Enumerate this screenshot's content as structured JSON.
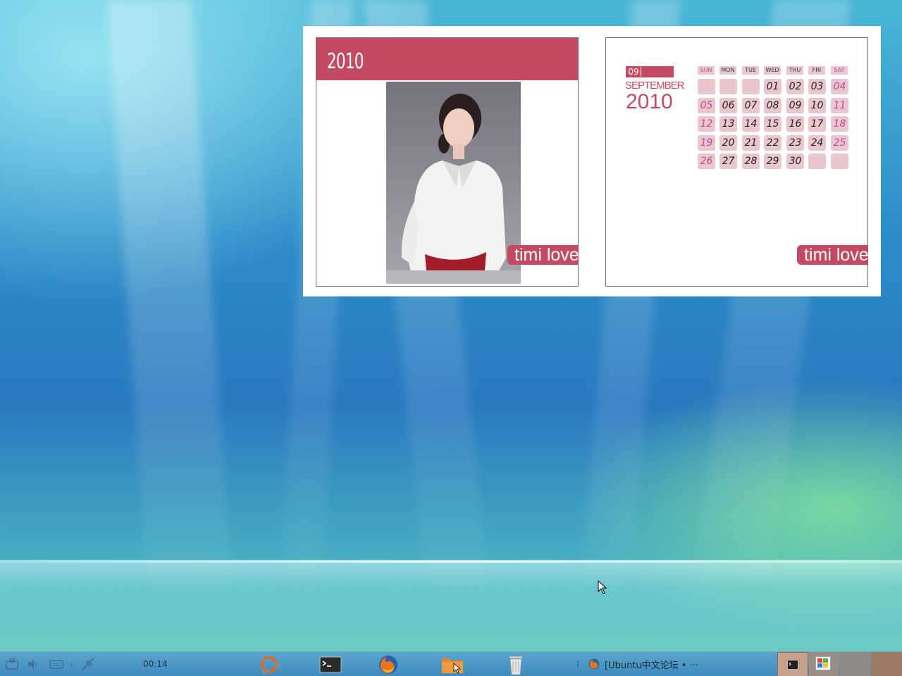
{
  "calendar": {
    "photo_year": "2010",
    "photo_tag": "timi love",
    "month_number": "09",
    "month_name": "SEPTEMBER",
    "year": "2010",
    "calendar_tag": "timi love",
    "weekdays": [
      "SUN",
      "MON",
      "TUE",
      "WED",
      "THU",
      "FRI",
      "SAT"
    ],
    "weeks": [
      [
        "",
        "",
        "",
        "01",
        "02",
        "03",
        "04"
      ],
      [
        "05",
        "06",
        "07",
        "08",
        "09",
        "10",
        "11"
      ],
      [
        "12",
        "13",
        "14",
        "15",
        "16",
        "17",
        "18"
      ],
      [
        "19",
        "20",
        "21",
        "22",
        "23",
        "24",
        "25"
      ],
      [
        "26",
        "27",
        "28",
        "29",
        "30",
        "",
        ""
      ]
    ],
    "accent_color": "#c34a62",
    "weekend_color": "#c04a9a"
  },
  "taskbar": {
    "clock": "00:14",
    "tray_icons": [
      "briefcase-icon",
      "volume-icon",
      "keyboard-icon",
      "menu-dots-icon",
      "network-plug-icon"
    ],
    "launchers": [
      "ubuntu-logo-icon",
      "terminal-icon",
      "firefox-icon",
      "file-manager-icon",
      "trash-icon"
    ],
    "window_title": "[Ubuntu中文论坛 • ···",
    "task_buttons": [
      "terminal-task",
      "windows-task"
    ]
  }
}
